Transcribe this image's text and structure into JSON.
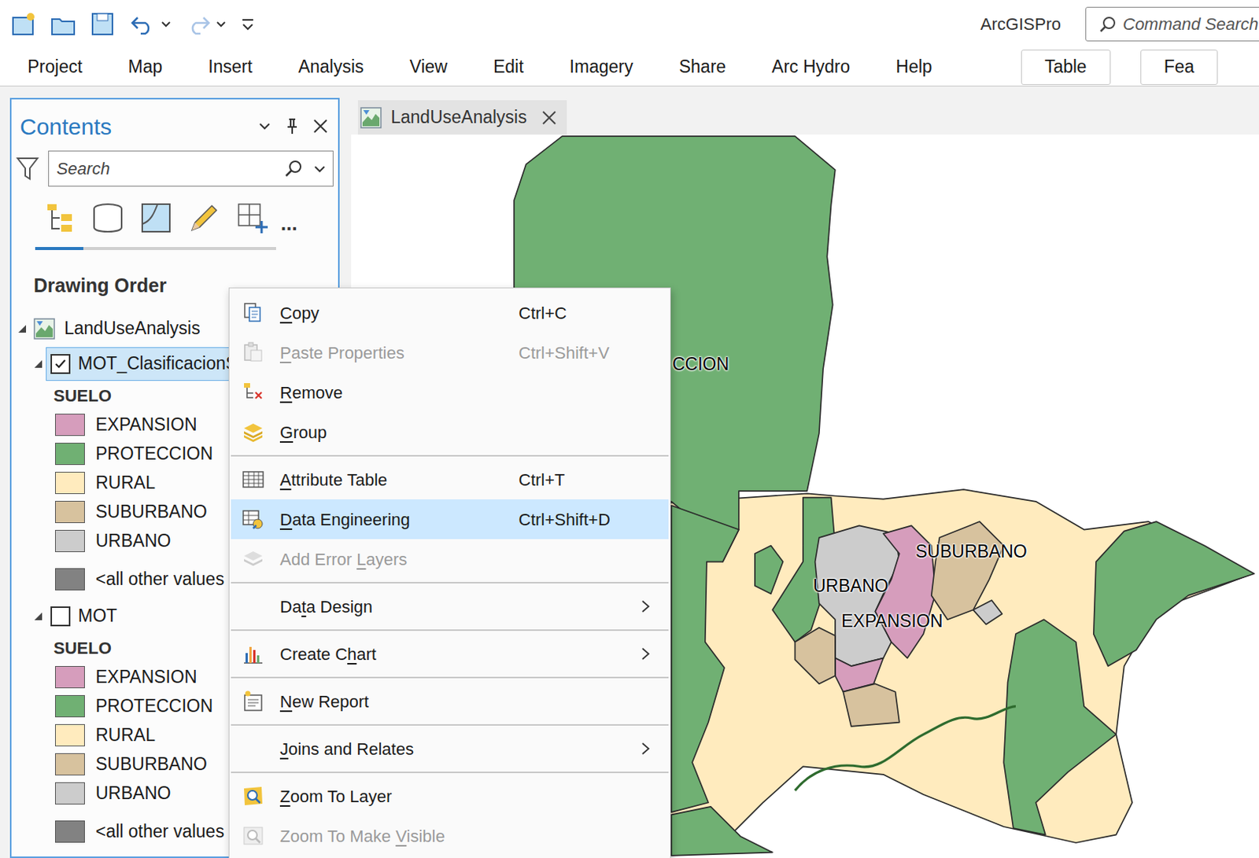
{
  "app": {
    "title": "ArcGISPro",
    "command_search": {
      "placeholder": "Command Search"
    }
  },
  "ribbon_tabs": [
    {
      "label": "Project",
      "kind": "tab",
      "selected": false
    },
    {
      "label": "Map",
      "kind": "tab",
      "selected": false
    },
    {
      "label": "Insert",
      "kind": "tab",
      "selected": false
    },
    {
      "label": "Analysis",
      "kind": "tab",
      "selected": false
    },
    {
      "label": "View",
      "kind": "tab",
      "selected": false
    },
    {
      "label": "Edit",
      "kind": "tab",
      "selected": false
    },
    {
      "label": "Imagery",
      "kind": "tab",
      "selected": false
    },
    {
      "label": "Share",
      "kind": "tab",
      "selected": false
    },
    {
      "label": "Arc Hydro",
      "kind": "tab",
      "selected": false
    },
    {
      "label": "Help",
      "kind": "tab",
      "selected": false
    },
    {
      "label": "Table",
      "kind": "contextual",
      "selected": false
    },
    {
      "label": "Fea",
      "kind": "contextual",
      "selected": false
    }
  ],
  "contents": {
    "title": "Contents",
    "search": {
      "placeholder": "Search"
    },
    "views": [
      {
        "selected": true
      },
      {
        "selected": false
      },
      {
        "selected": false
      },
      {
        "selected": false
      },
      {
        "selected": false
      }
    ],
    "more": "...",
    "heading": "Drawing Order",
    "map": {
      "label": "LandUseAnalysis",
      "expanded": true
    },
    "layers": [
      {
        "label": "MOT_ClasificacionS",
        "checked": true,
        "selected": true,
        "expanded": true,
        "field": "SUELO",
        "legend": [
          {
            "label": "EXPANSION",
            "color": "#d69dbc"
          },
          {
            "label": "PROTECCION",
            "color": "#70b073"
          },
          {
            "label": "RURAL",
            "color": "#ffebbe"
          },
          {
            "label": "SUBURBANO",
            "color": "#d7c29e"
          },
          {
            "label": "URBANO",
            "color": "#cccccc"
          },
          {
            "label": "<all other values",
            "color": "#828282"
          }
        ]
      },
      {
        "label": "MOT",
        "checked": false,
        "selected": false,
        "expanded": true,
        "field": "SUELO",
        "legend": [
          {
            "label": "EXPANSION",
            "color": "#d69dbc"
          },
          {
            "label": "PROTECCION",
            "color": "#70b073"
          },
          {
            "label": "RURAL",
            "color": "#ffebbe"
          },
          {
            "label": "SUBURBANO",
            "color": "#d7c29e"
          },
          {
            "label": "URBANO",
            "color": "#cccccc"
          },
          {
            "label": "<all other values",
            "color": "#828282"
          }
        ]
      }
    ]
  },
  "map_view": {
    "tab": {
      "label": "LandUseAnalysis",
      "selected": true
    },
    "labels": [
      "CCION",
      "SUBURBANO",
      "URBANO",
      "EXPANSION"
    ]
  },
  "context_menu": {
    "groups": [
      [
        {
          "label": "Copy",
          "shortcut": "Ctrl+C",
          "disabled": false,
          "selected": false,
          "submenu": false,
          "underline": 0
        },
        {
          "label": "Paste Properties",
          "shortcut": "Ctrl+Shift+V",
          "disabled": true,
          "selected": false,
          "submenu": false,
          "underline": 0
        },
        {
          "label": "Remove",
          "disabled": false,
          "selected": false,
          "submenu": false,
          "underline": 0
        },
        {
          "label": "Group",
          "disabled": false,
          "selected": false,
          "submenu": false,
          "underline": 0
        }
      ],
      [
        {
          "label": "Attribute Table",
          "shortcut": "Ctrl+T",
          "disabled": false,
          "selected": false,
          "submenu": false,
          "underline": 0
        },
        {
          "label": "Data Engineering",
          "shortcut": "Ctrl+Shift+D",
          "disabled": false,
          "selected": true,
          "submenu": false,
          "underline": 0
        },
        {
          "label": "Add Error Layers",
          "disabled": true,
          "selected": false,
          "submenu": false,
          "underline": 10
        }
      ],
      [
        {
          "label": "Data Design",
          "disabled": false,
          "selected": false,
          "submenu": true,
          "underline": 2
        }
      ],
      [
        {
          "label": "Create Chart",
          "disabled": false,
          "selected": false,
          "submenu": true,
          "underline": 8
        }
      ],
      [
        {
          "label": "New Report",
          "disabled": false,
          "selected": false,
          "submenu": false,
          "underline": 0
        }
      ],
      [
        {
          "label": "Joins and Relates",
          "disabled": false,
          "selected": false,
          "submenu": true,
          "underline": 0
        }
      ],
      [
        {
          "label": "Zoom To Layer",
          "disabled": false,
          "selected": false,
          "submenu": false,
          "underline": 0
        },
        {
          "label": "Zoom To Make Visible",
          "disabled": true,
          "selected": false,
          "submenu": false,
          "underline": 13
        }
      ]
    ]
  }
}
